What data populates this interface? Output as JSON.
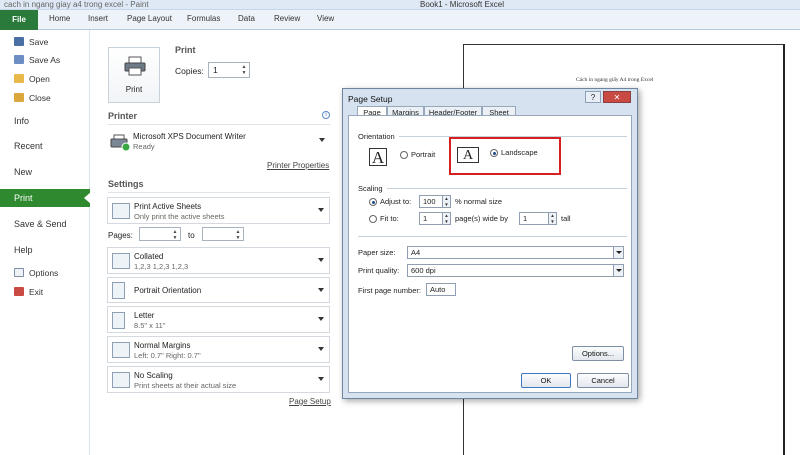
{
  "window": {
    "title": "Book1 - Microsoft Excel",
    "quick_access": "cach in ngang giay a4 trong excel - Paint"
  },
  "ribbon": {
    "tabs": [
      {
        "label": "File"
      },
      {
        "label": "Home"
      },
      {
        "label": "Insert"
      },
      {
        "label": "Page Layout"
      },
      {
        "label": "Formulas"
      },
      {
        "label": "Data"
      },
      {
        "label": "Review"
      },
      {
        "label": "View"
      }
    ]
  },
  "nav": {
    "save": "Save",
    "save_as": "Save As",
    "open": "Open",
    "close": "Close",
    "info": "Info",
    "recent": "Recent",
    "new": "New",
    "print": "Print",
    "save_send": "Save & Send",
    "help": "Help",
    "options": "Options",
    "exit": "Exit"
  },
  "print": {
    "heading": "Print",
    "button_label": "Print",
    "copies_label": "Copies:",
    "copies_value": "1",
    "printer_heading": "Printer",
    "printer_name": "Microsoft XPS Document Writer",
    "printer_status": "Ready",
    "printer_properties": "Printer Properties",
    "settings_heading": "Settings",
    "print_what": "Print Active Sheets",
    "print_what_desc": "Only print the active sheets",
    "pages_label": "Pages:",
    "to_label": "to",
    "collated": "Collated",
    "collated_desc": "1,2,3    1,2,3    1,2,3",
    "orientation": "Portrait Orientation",
    "paper": "Letter",
    "paper_desc": "8.5\" x 11\"",
    "margins": "Normal Margins",
    "margins_desc": "Left: 0.7\"    Right: 0.7\"",
    "scaling": "No Scaling",
    "scaling_desc": "Print sheets at their actual size",
    "page_setup_link": "Page Setup"
  },
  "preview": {
    "text": "Cách in ngang giấy A4 trong Excel"
  },
  "dialog": {
    "title": "Page Setup",
    "help": "?",
    "close": "✕",
    "tabs": [
      "Page",
      "Margins",
      "Header/Footer",
      "Sheet"
    ],
    "orientation_label": "Orientation",
    "portrait": "Portrait",
    "landscape": "Landscape",
    "scaling_label": "Scaling",
    "adjust_to": "Adjust to:",
    "adjust_value": "100",
    "normal_size": "% normal size",
    "fit_to": "Fit to:",
    "fit_wide": "1",
    "pages_wide_by": "page(s) wide by",
    "fit_tall": "1",
    "tall": "tall",
    "paper_size_label": "Paper size:",
    "paper_size_value": "A4",
    "print_quality_label": "Print quality:",
    "print_quality_value": "600 dpi",
    "first_page_label": "First page number:",
    "first_page_value": "Auto",
    "options_button": "Options...",
    "ok_button": "OK",
    "cancel_button": "Cancel"
  },
  "colors": {
    "file_tab": "#2a7a3b",
    "print_active": "#2f8a2f",
    "highlight": "#d62020"
  }
}
